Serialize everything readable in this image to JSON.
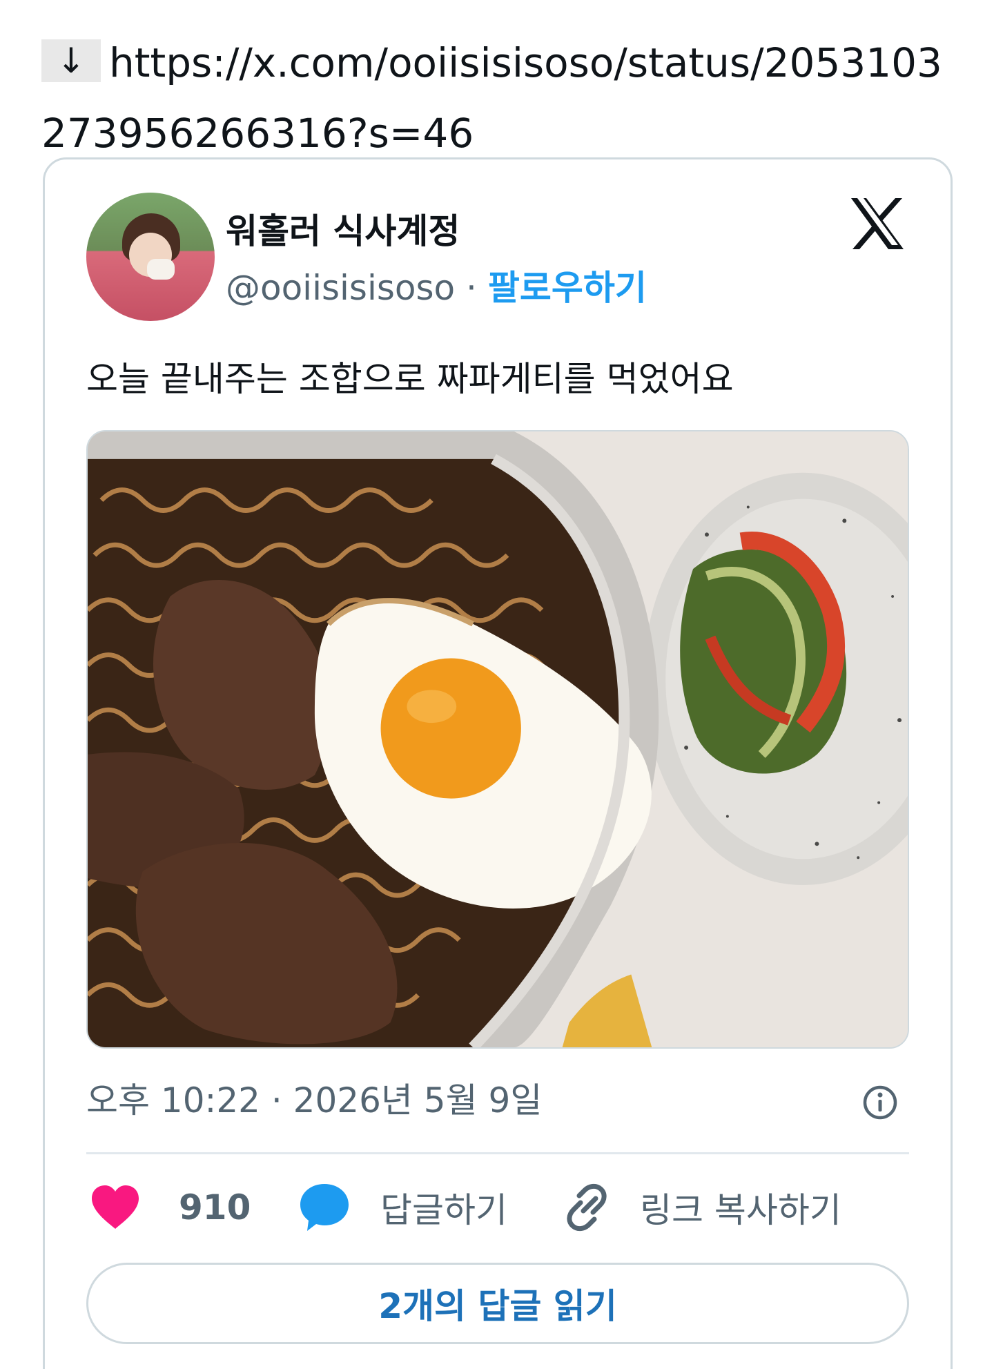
{
  "link": {
    "arrow": "↓",
    "url": "https://x.com/ooiisisisoso/status/2053103273956266316?s=46"
  },
  "tweet": {
    "display_name": "워홀러 식사계정",
    "handle": "@ooiisisisoso",
    "separator": " · ",
    "follow_label": "팔로우하기",
    "text": "오늘 끝내주는 조합으로 짜파게티를 먹었어요",
    "timestamp": "오후 10:22 · 2026년 5월 9일",
    "like_count": "910",
    "reply_label": "답글하기",
    "copy_link_label": "링크 복사하기",
    "read_replies_label": "2개의 답글 읽기"
  },
  "icons": {
    "logo": "x-logo-icon",
    "info": "info-icon",
    "like": "heart-icon",
    "reply": "speech-bubble-icon",
    "copy": "link-icon"
  },
  "colors": {
    "accent": "#1d9bf0",
    "heart": "#f91880",
    "secondary_text": "#536471",
    "border": "#cfd9de"
  }
}
